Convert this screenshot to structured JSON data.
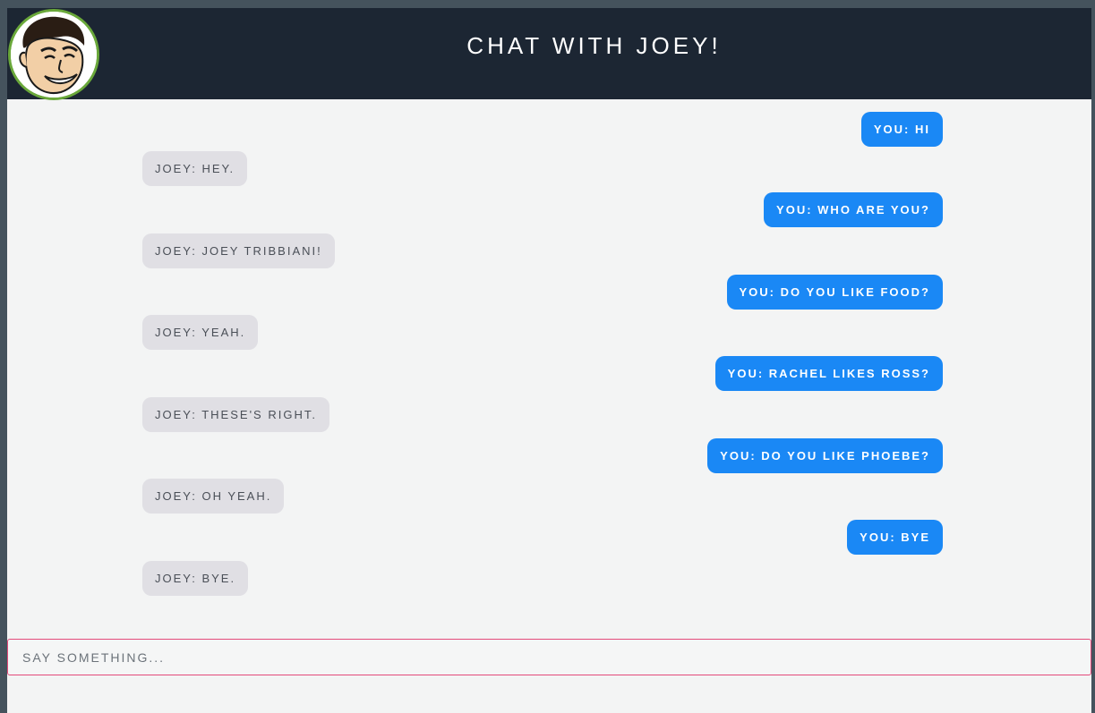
{
  "header": {
    "title": "CHAT WITH JOEY!"
  },
  "messages": [
    {
      "sender": "you",
      "text": "YOU: HI"
    },
    {
      "sender": "joey",
      "text": "JOEY: HEY."
    },
    {
      "sender": "you",
      "text": "YOU: WHO ARE YOU?"
    },
    {
      "sender": "joey",
      "text": "JOEY: JOEY TRIBBIANI!"
    },
    {
      "sender": "you",
      "text": "YOU: DO YOU LIKE FOOD?"
    },
    {
      "sender": "joey",
      "text": "JOEY: YEAH."
    },
    {
      "sender": "you",
      "text": "YOU: RACHEL LIKES ROSS?"
    },
    {
      "sender": "joey",
      "text": "JOEY: THESE'S RIGHT."
    },
    {
      "sender": "you",
      "text": "YOU: DO YOU LIKE PHOEBE?"
    },
    {
      "sender": "joey",
      "text": "JOEY: OH YEAH."
    },
    {
      "sender": "you",
      "text": "YOU: BYE"
    },
    {
      "sender": "joey",
      "text": "JOEY: BYE."
    }
  ],
  "composer": {
    "placeholder": "SAY SOMETHING..."
  },
  "colors": {
    "header_bg": "#1c2633",
    "you_bubble": "#1a88f5",
    "joey_bubble": "#e0dfe4",
    "input_border": "#e34a7a",
    "avatar_ring": "#6aa83a"
  },
  "icons": {
    "avatar": "joey-avatar-icon"
  }
}
